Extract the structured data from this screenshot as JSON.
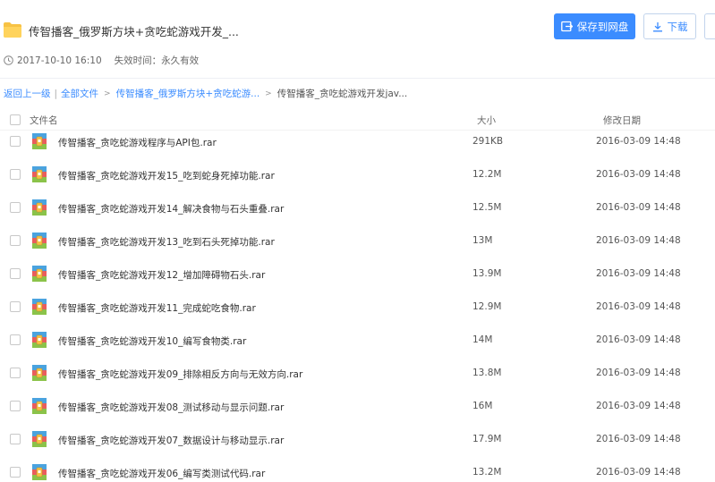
{
  "header": {
    "title": "传智播客_俄罗斯方块+贪吃蛇游戏开发_...",
    "created": "2017-10-10 16:10",
    "expire": "失效时间：永久有效",
    "save_label": "保存到网盘",
    "download_label": "下载",
    "accent": "#3b8cff"
  },
  "breadcrumb": {
    "back": "返回上一级",
    "all_files": "全部文件",
    "parent": "传智播客_俄罗斯方块+贪吃蛇游...",
    "current": "传智播客_贪吃蛇游戏开发jav..."
  },
  "columns": {
    "name": "文件名",
    "size": "大小",
    "date": "修改日期"
  },
  "files": [
    {
      "name": "传智播客_贪吃蛇游戏程序与API包.rar",
      "size": "291KB",
      "date": "2016-03-09 14:48",
      "icon": "rar-archive-icon"
    },
    {
      "name": "传智播客_贪吃蛇游戏开发15_吃到蛇身死掉功能.rar",
      "size": "12.2M",
      "date": "2016-03-09 14:48",
      "icon": "rar-archive-icon"
    },
    {
      "name": "传智播客_贪吃蛇游戏开发14_解决食物与石头重叠.rar",
      "size": "12.5M",
      "date": "2016-03-09 14:48",
      "icon": "rar-archive-icon"
    },
    {
      "name": "传智播客_贪吃蛇游戏开发13_吃到石头死掉功能.rar",
      "size": "13M",
      "date": "2016-03-09 14:48",
      "icon": "rar-archive-icon"
    },
    {
      "name": "传智播客_贪吃蛇游戏开发12_增加障碍物石头.rar",
      "size": "13.9M",
      "date": "2016-03-09 14:48",
      "icon": "rar-archive-icon"
    },
    {
      "name": "传智播客_贪吃蛇游戏开发11_完成蛇吃食物.rar",
      "size": "12.9M",
      "date": "2016-03-09 14:48",
      "icon": "rar-archive-icon"
    },
    {
      "name": "传智播客_贪吃蛇游戏开发10_编写食物类.rar",
      "size": "14M",
      "date": "2016-03-09 14:48",
      "icon": "rar-archive-icon"
    },
    {
      "name": "传智播客_贪吃蛇游戏开发09_排除相反方向与无效方向.rar",
      "size": "13.8M",
      "date": "2016-03-09 14:48",
      "icon": "rar-archive-icon"
    },
    {
      "name": "传智播客_贪吃蛇游戏开发08_测试移动与显示问题.rar",
      "size": "16M",
      "date": "2016-03-09 14:48",
      "icon": "rar-archive-icon"
    },
    {
      "name": "传智播客_贪吃蛇游戏开发07_数据设计与移动显示.rar",
      "size": "17.9M",
      "date": "2016-03-09 14:48",
      "icon": "rar-archive-icon"
    },
    {
      "name": "传智播客_贪吃蛇游戏开发06_编写类测试代码.rar",
      "size": "13.2M",
      "date": "2016-03-09 14:48",
      "icon": "rar-archive-icon"
    }
  ]
}
